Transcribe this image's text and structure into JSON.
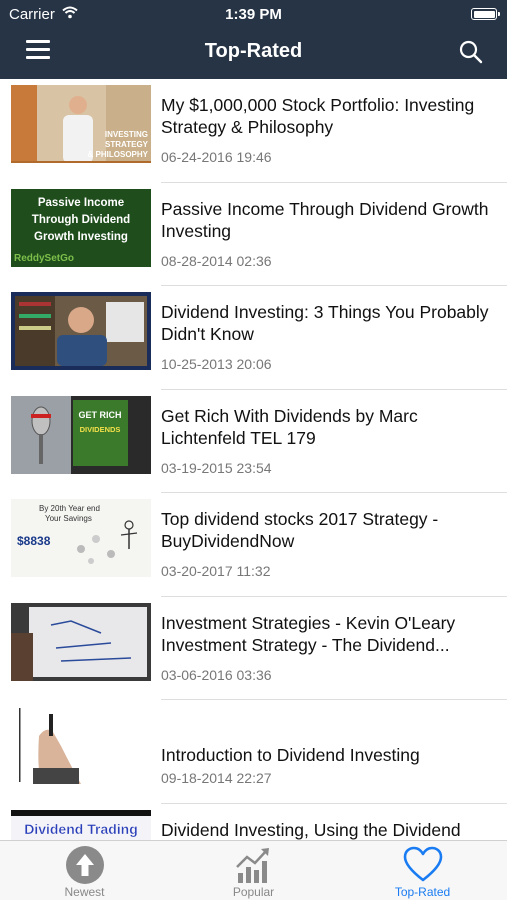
{
  "status": {
    "carrier": "Carrier",
    "time": "1:39 PM"
  },
  "header": {
    "title": "Top-Rated"
  },
  "thumb_texts": {
    "t1": [
      "INVESTING",
      "STRATEGY",
      "& PHILOSOPHY"
    ],
    "t2": [
      "Passive Income",
      "Through Dividend",
      "Growth Investing",
      "ReddySetGo"
    ],
    "t4": [
      "GET RICH",
      "DIVIDENDS"
    ],
    "t5": [
      "By 20th Year end",
      "Your Savings",
      "$8838"
    ],
    "t8": "Dividend Trading"
  },
  "videos": [
    {
      "title": "My $1,000,000 Stock Portfolio: Investing Strategy & Philosophy",
      "date": "06-24-2016 19:46"
    },
    {
      "title": "Passive Income Through Dividend Growth Investing",
      "date": "08-28-2014 02:36"
    },
    {
      "title": "Dividend Investing: 3 Things You Probably Didn't Know",
      "date": "10-25-2013 20:06"
    },
    {
      "title": "Get Rich With Dividends by Marc Lichtenfeld TEL 179",
      "date": "03-19-2015 23:54"
    },
    {
      "title": "Top dividend stocks 2017 Strategy - BuyDividendNow",
      "date": "03-20-2017 11:32"
    },
    {
      "title": "Investment Strategies - Kevin O'Leary Investment Strategy - The Dividend...",
      "date": "03-06-2016 03:36"
    },
    {
      "title": "Introduction to Dividend Investing",
      "date": "09-18-2014 22:27"
    },
    {
      "title": "Dividend Investing, Using the Dividend",
      "date": ""
    }
  ],
  "tabs": [
    {
      "label": "Newest",
      "icon": "arrow-up-circle-icon"
    },
    {
      "label": "Popular",
      "icon": "bar-chart-trend-icon"
    },
    {
      "label": "Top-Rated",
      "icon": "heart-icon"
    }
  ],
  "colors": {
    "nav_bg": "#263446",
    "accent": "#1a7cf2"
  }
}
